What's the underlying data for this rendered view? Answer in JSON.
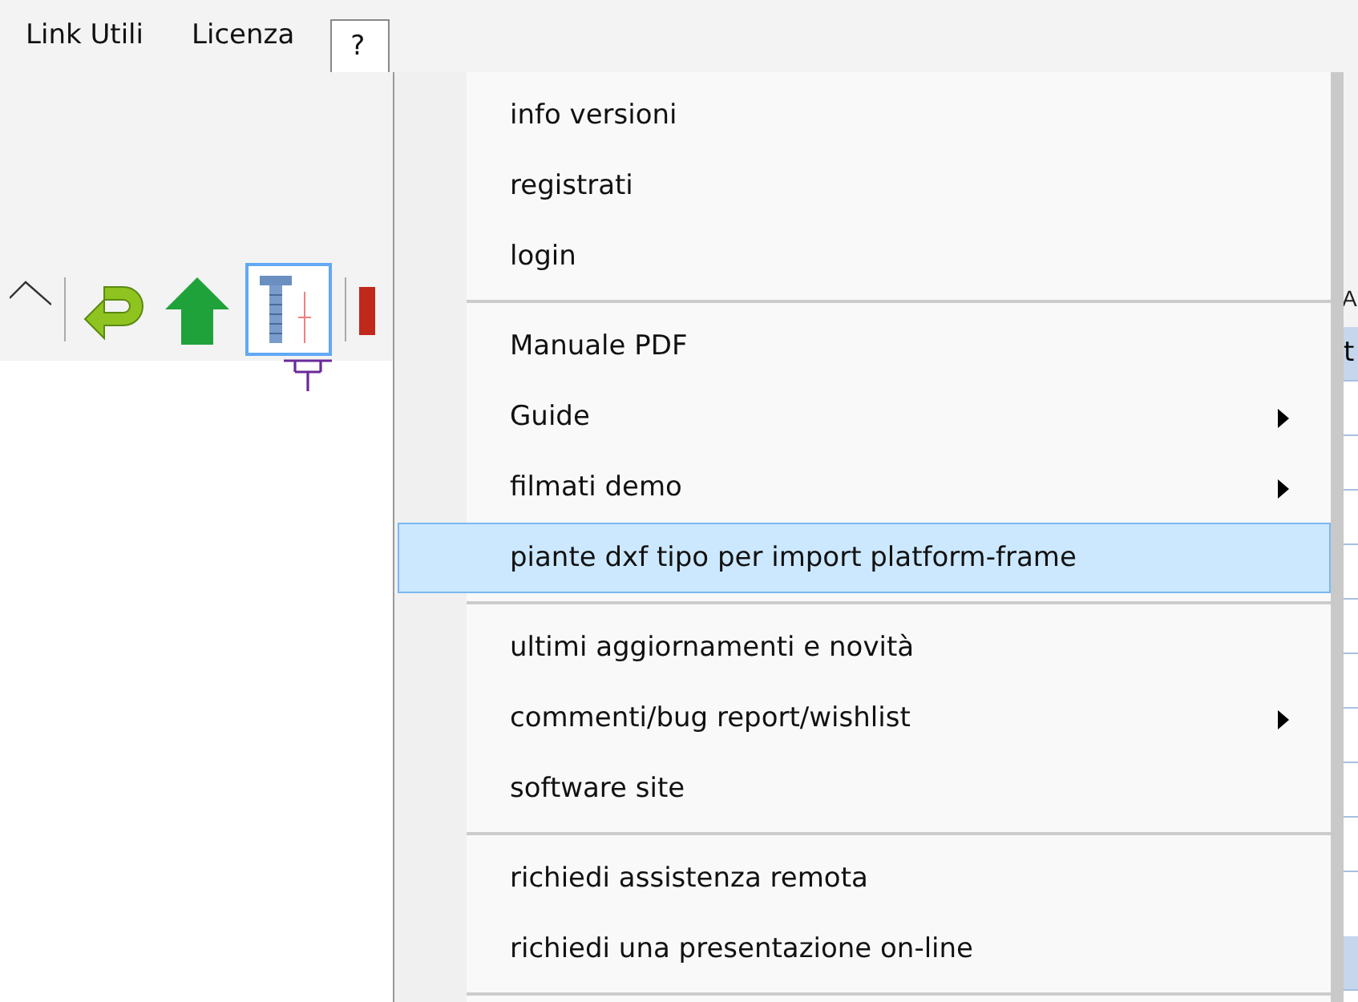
{
  "menubar": [
    {
      "label": "Link Utili",
      "selected": false
    },
    {
      "label": "Licenza",
      "selected": false
    },
    {
      "label": "?",
      "selected": true
    }
  ],
  "table": {
    "column_1": "A",
    "row_1": "t"
  },
  "menu": [
    {
      "kind": "item",
      "label": "info versioni",
      "submenu": false,
      "selected": false
    },
    {
      "kind": "item",
      "label": "registrati",
      "submenu": false,
      "selected": false
    },
    {
      "kind": "item",
      "label": "login",
      "submenu": false,
      "selected": false
    },
    {
      "kind": "separator"
    },
    {
      "kind": "item",
      "label": "Manuale PDF",
      "submenu": false,
      "selected": false
    },
    {
      "kind": "item",
      "label": "Guide",
      "submenu": true,
      "selected": false
    },
    {
      "kind": "item",
      "label": "filmati demo",
      "submenu": true,
      "selected": false
    },
    {
      "kind": "item",
      "label": "piante dxf tipo per import platform-frame",
      "submenu": false,
      "selected": true
    },
    {
      "kind": "separator"
    },
    {
      "kind": "item",
      "label": "ultimi aggiornamenti e novità",
      "submenu": false,
      "selected": false
    },
    {
      "kind": "item",
      "label": "commenti/bug report/wishlist",
      "submenu": true,
      "selected": false
    },
    {
      "kind": "item",
      "label": "software site",
      "submenu": false,
      "selected": false
    },
    {
      "kind": "separator"
    },
    {
      "kind": "item",
      "label": "richiedi assistenza remota",
      "submenu": false,
      "selected": false
    },
    {
      "kind": "item",
      "label": "richiedi una presentazione on-line",
      "submenu": false,
      "selected": false
    },
    {
      "kind": "separator"
    }
  ]
}
